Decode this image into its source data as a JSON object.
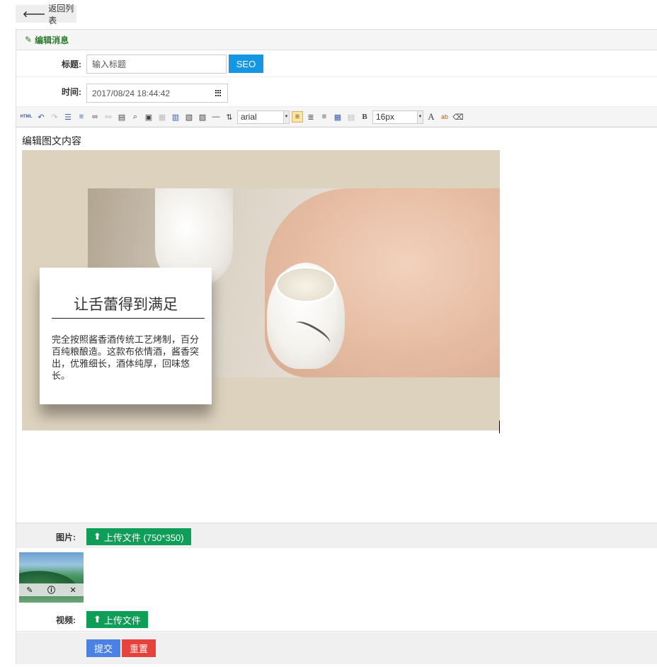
{
  "back_button": {
    "label": "返回列表",
    "icon": "arrow-left-icon"
  },
  "panel": {
    "title": "编辑消息",
    "icon": "pencil-icon"
  },
  "form": {
    "title": {
      "label": "标题:",
      "placeholder": "输入标题",
      "value": "",
      "seo_label": "SEO"
    },
    "time": {
      "label": "时间:",
      "value": "2017/08/24 18:44:42",
      "icon": "calendar-icon"
    }
  },
  "toolbar": {
    "html_label": "HTML",
    "font_family": "arial",
    "font_size": "16px",
    "bold_label": "B",
    "color_label": "A",
    "highlight_label": "ab",
    "hr_label": "—"
  },
  "editor": {
    "intro_text": "编辑图文内容",
    "banner": {
      "heading": "让舌蕾得到满足",
      "body": "完全按照酱香酒传统工艺烤制，百分百纯粮酿造。这款布依情酒，酱香突出，优雅细长，酒体纯厚，回味悠长。",
      "background_color": "#ddd2bd"
    }
  },
  "image_field": {
    "label": "图片:",
    "upload_label": "上传文件 (750*350)"
  },
  "video_field": {
    "label": "视频:",
    "upload_label": "上传文件"
  },
  "actions": {
    "submit_label": "提交",
    "reset_label": "重置"
  },
  "colors": {
    "green": "#0e9e58",
    "blue": "#1496e3",
    "submit": "#4a81e2",
    "reset": "#e5413d",
    "heading_green": "#2d7a2d"
  }
}
